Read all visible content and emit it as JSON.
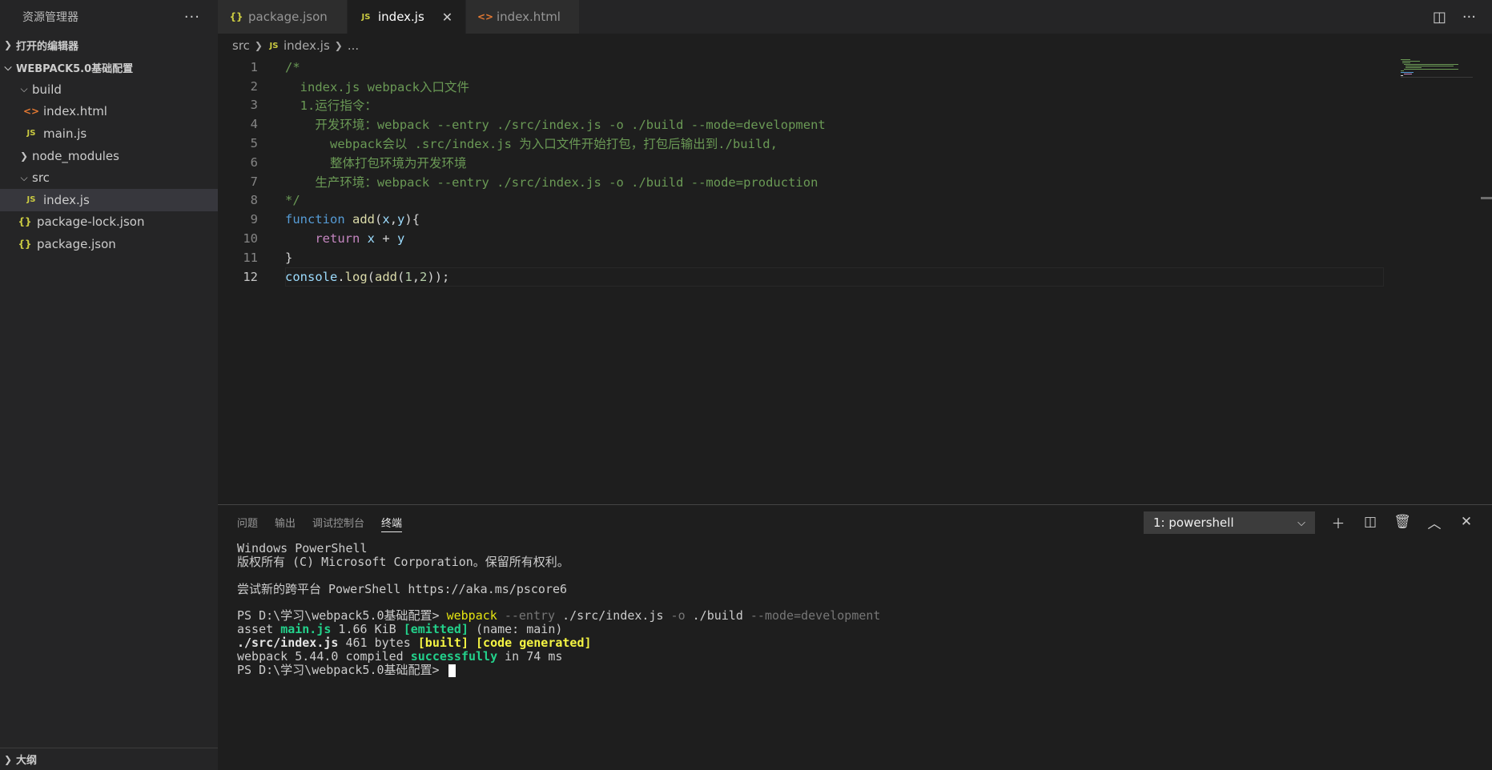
{
  "sidebar": {
    "title": "资源管理器",
    "more_label": "···",
    "open_editors_label": "打开的编辑器",
    "project_label": "WEBPACK5.0基础配置",
    "tree": [
      {
        "label": "build",
        "kind": "folder-open"
      },
      {
        "label": "index.html",
        "kind": "html"
      },
      {
        "label": "main.js",
        "kind": "js"
      },
      {
        "label": "node_modules",
        "kind": "folder-closed"
      },
      {
        "label": "src",
        "kind": "folder-open"
      },
      {
        "label": "index.js",
        "kind": "js",
        "selected": true
      },
      {
        "label": "package-lock.json",
        "kind": "json"
      },
      {
        "label": "package.json",
        "kind": "json"
      }
    ],
    "outline_label": "大纲"
  },
  "tabs": [
    {
      "label": "package.json",
      "icon": "{}"
    },
    {
      "label": "index.js",
      "icon": "JS",
      "active": true
    },
    {
      "label": "index.html",
      "icon": "<>"
    }
  ],
  "icons": {
    "json": "{}",
    "js": "JS",
    "html": "<>",
    "close": "✕",
    "chevron_right": "›",
    "chevron_down": "⌄"
  },
  "breadcrumb": {
    "folder": "src",
    "file_icon": "JS",
    "file": "index.js",
    "more": "..."
  },
  "editor": {
    "current_line": 12,
    "lines": [
      {
        "n": "1",
        "text": "/*"
      },
      {
        "n": "2",
        "text": "  index.js webpack入口文件"
      },
      {
        "n": "3",
        "text": "  1.运行指令："
      },
      {
        "n": "4",
        "text": "    开发环境：webpack --entry ./src/index.js -o ./build --mode=development"
      },
      {
        "n": "5",
        "text": "      webpack会以 .src/index.js 为入口文件开始打包，打包后输出到./build,"
      },
      {
        "n": "6",
        "text": "      整体打包环境为开发环境"
      },
      {
        "n": "7",
        "text": "    生产环境：webpack --entry ./src/index.js -o ./build --mode=production"
      },
      {
        "n": "8",
        "text": "*/"
      },
      {
        "n": "9",
        "text": "function add(x,y){"
      },
      {
        "n": "10",
        "text": "    return x + y"
      },
      {
        "n": "11",
        "text": "}"
      },
      {
        "n": "12",
        "text": "console.log(add(1,2));"
      }
    ]
  },
  "panel": {
    "tabs": [
      "问题",
      "输出",
      "调试控制台",
      "终端"
    ],
    "active_tab": "终端",
    "terminal_select": "1: powershell",
    "terminal": {
      "l1": "Windows PowerShell",
      "l2": "版权所有 (C) Microsoft Corporation。保留所有权利。",
      "l3": "尝试新的跨平台 PowerShell https://aka.ms/pscore6",
      "prompt": "PS D:\\学习\\webpack5.0基础配置> ",
      "cmd_webpack": "webpack",
      "cmd_entry_flag": " --entry",
      "cmd_entry_val": " ./src/index.js",
      "cmd_o_flag": " -o",
      "cmd_o_val": " ./build",
      "cmd_mode": " --mode=development",
      "asset_prefix": "asset ",
      "asset_name": "main.js",
      "asset_size": " 1.66 KiB ",
      "asset_emitted": "[emitted]",
      "asset_suffix": " (name: main)",
      "mod_name": "./src/index.js",
      "mod_size": " 461 bytes ",
      "mod_built": "[built]",
      "mod_gen": "[code generated]",
      "compiled_prefix": "webpack 5.44.0 compiled ",
      "compiled_status": "successfully",
      "compiled_suffix": " in 74 ms"
    }
  }
}
